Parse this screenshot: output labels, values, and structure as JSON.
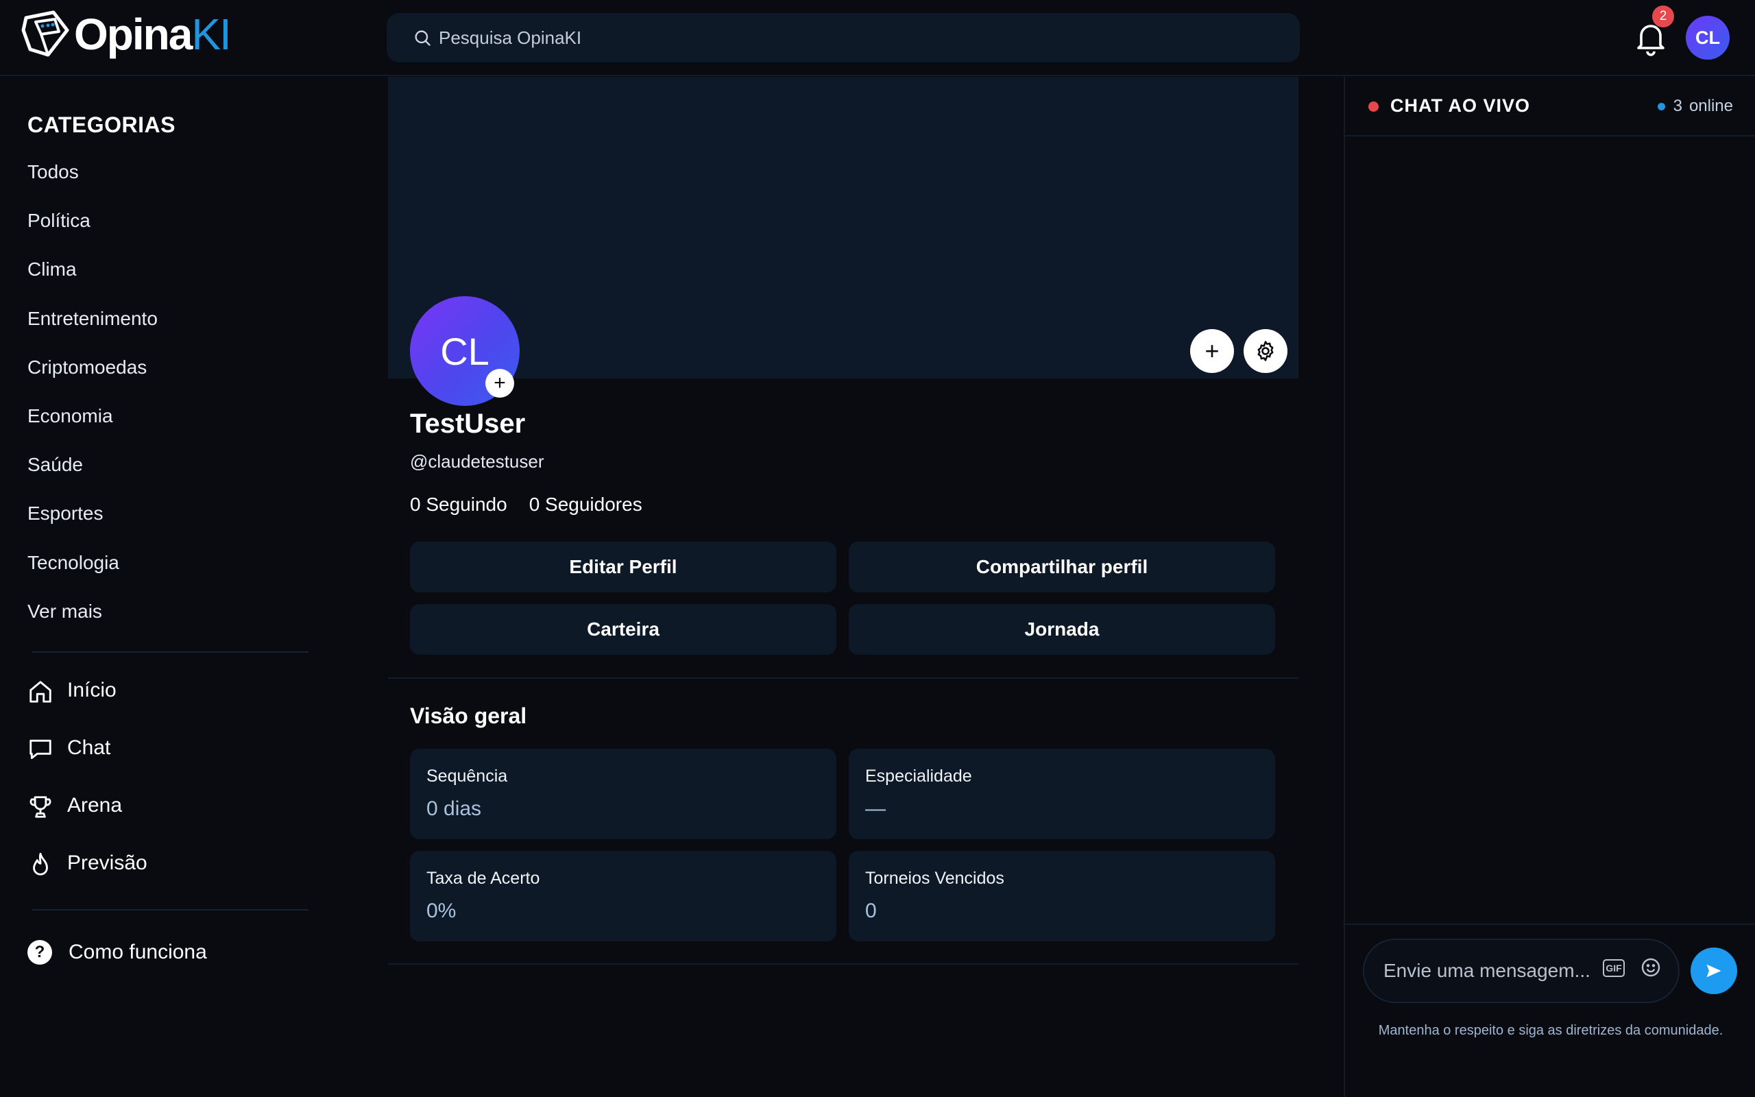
{
  "header": {
    "logo_main": "Opina",
    "logo_accent": "KI",
    "search_placeholder": "Pesquisa OpinaKI",
    "notification_count": "2",
    "user_initials": "CL"
  },
  "sidebar": {
    "categories_title": "CATEGORIAS",
    "categories": [
      "Todos",
      "Política",
      "Clima",
      "Entretenimento",
      "Criptomoedas",
      "Economia",
      "Saúde",
      "Esportes",
      "Tecnologia",
      "Ver mais"
    ],
    "nav": [
      {
        "label": "Início",
        "icon": "home-icon"
      },
      {
        "label": "Chat",
        "icon": "chat-bubble-icon"
      },
      {
        "label": "Arena",
        "icon": "trophy-icon"
      },
      {
        "label": "Previsão",
        "icon": "flame-icon"
      }
    ],
    "help_label": "Como funciona",
    "help_icon": "question-circle-icon"
  },
  "profile": {
    "initials": "CL",
    "display_name": "TestUser",
    "handle": "@claudetestuser",
    "following": "0 Seguindo",
    "followers": "0 Seguidores",
    "buttons": {
      "edit": "Editar Perfil",
      "share": "Compartilhar perfil",
      "wallet": "Carteira",
      "journey": "Jornada"
    },
    "overview_title": "Visão geral",
    "stats": [
      {
        "label": "Sequência",
        "value": "0 dias"
      },
      {
        "label": "Especialidade",
        "value": "—"
      },
      {
        "label": "Taxa de Acerto",
        "value": "0%"
      },
      {
        "label": "Torneios Vencidos",
        "value": "0"
      }
    ]
  },
  "chat": {
    "title": "CHAT AO VIVO",
    "online_count": "3",
    "online_label": "online",
    "input_placeholder": "Envie uma mensagem...",
    "gif_label": "GIF",
    "footer_note": "Mantenha o respeito e siga as diretrizes da comunidade."
  },
  "colors": {
    "background": "#0a0b10",
    "panel": "#0e1928",
    "accent": "#2294e0",
    "avatar_gradient_start": "#7a35f5",
    "avatar_gradient_end": "#3b5cf0",
    "alert_red": "#e5484d"
  }
}
